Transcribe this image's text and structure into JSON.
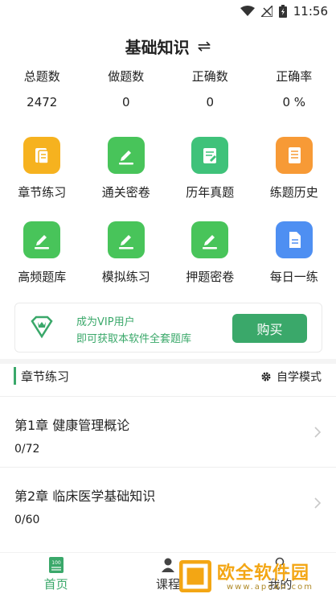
{
  "status_bar": {
    "time": "11:56",
    "icons": [
      "wifi-icon",
      "no-signal-icon",
      "battery-charging-icon"
    ]
  },
  "header": {
    "title": "基础知识",
    "switch_icon": "⇌"
  },
  "stats": [
    {
      "label": "总题数",
      "value": "2472"
    },
    {
      "label": "做题数",
      "value": "0"
    },
    {
      "label": "正确数",
      "value": "0"
    },
    {
      "label": "正确率",
      "value": "0 %"
    }
  ],
  "grid": [
    {
      "label": "章节练习",
      "icon": "chapter-practice-icon",
      "color": "#f6b21f"
    },
    {
      "label": "通关密卷",
      "icon": "pass-exam-icon",
      "color": "#48c45a"
    },
    {
      "label": "历年真题",
      "icon": "past-exam-icon",
      "color": "#3fc27a"
    },
    {
      "label": "练题历史",
      "icon": "history-icon",
      "color": "#f79a36"
    },
    {
      "label": "高频题库",
      "icon": "high-frequency-icon",
      "color": "#48c45a"
    },
    {
      "label": "模拟练习",
      "icon": "mock-practice-icon",
      "color": "#48c45a"
    },
    {
      "label": "押题密卷",
      "icon": "predicted-exam-icon",
      "color": "#48c45a"
    },
    {
      "label": "每日一练",
      "icon": "daily-practice-icon",
      "color": "#4e8ff2"
    }
  ],
  "vip": {
    "line1": "成为VIP用户",
    "line2": "即可获取本软件全套题库",
    "button": "购买"
  },
  "section": {
    "title": "章节练习",
    "mode_label": "自学模式"
  },
  "chapters": [
    {
      "title": "第1章 健康管理概论",
      "progress": "0/72"
    },
    {
      "title": "第2章 临床医学基础知识",
      "progress": "0/60"
    }
  ],
  "tabs": [
    {
      "label": "首页",
      "icon": "home-icon",
      "active": true
    },
    {
      "label": "课程",
      "icon": "course-icon",
      "active": false
    },
    {
      "label": "我的",
      "icon": "profile-icon",
      "active": false
    }
  ],
  "watermark": {
    "title": "欧全软件园",
    "url": "www.apcdn.com"
  },
  "colors": {
    "accent": "#3aa86a"
  }
}
